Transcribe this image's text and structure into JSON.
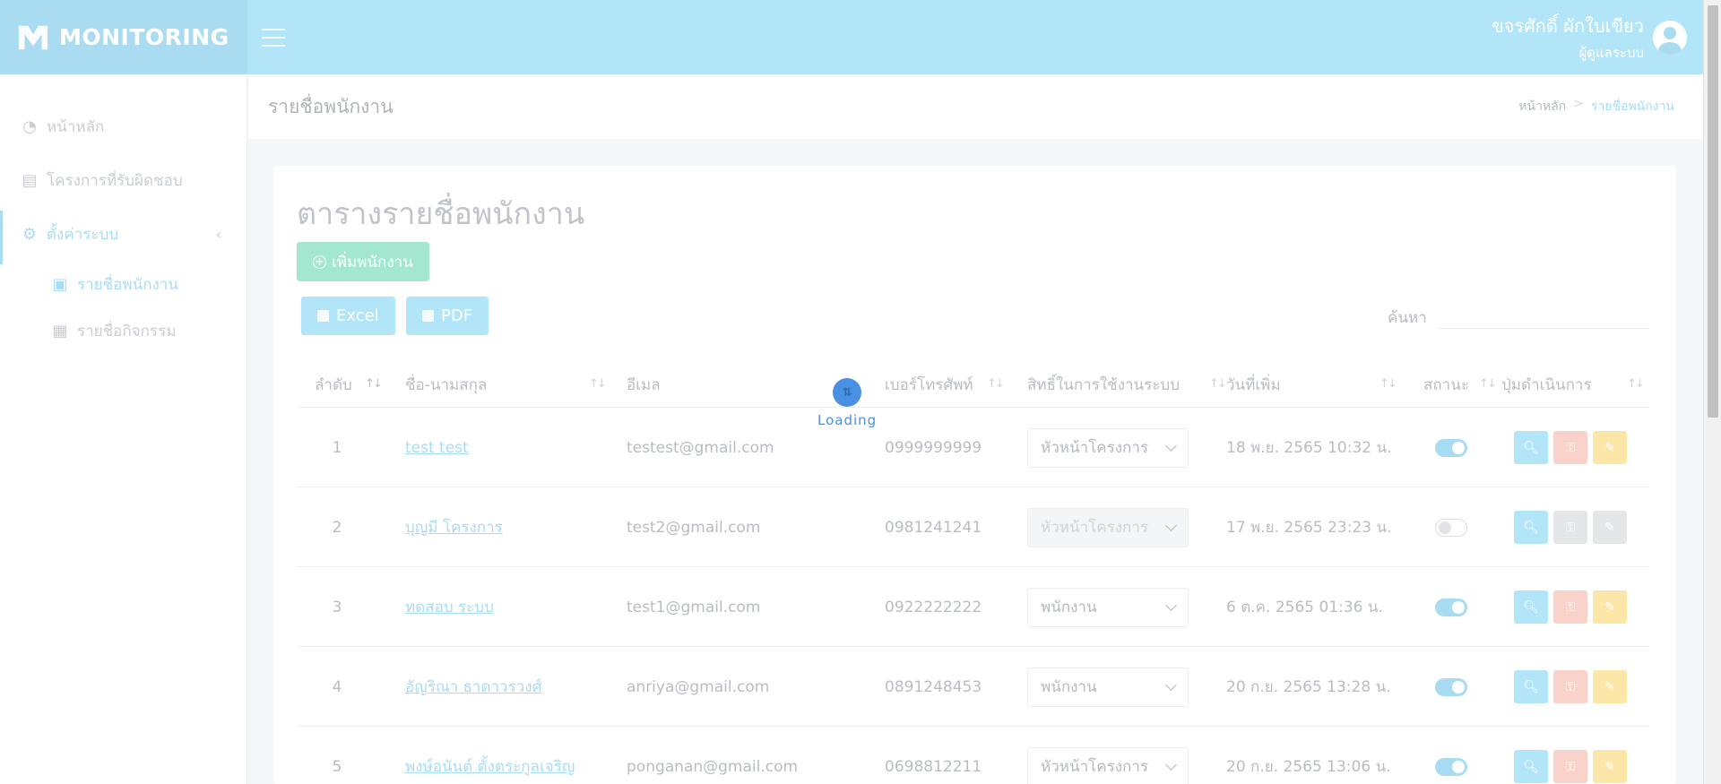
{
  "brand": {
    "name": "MONITORING"
  },
  "user": {
    "name": "ขจรศักดิ์ ผักใบเขียว",
    "role": "ผู้ดูแลระบบ"
  },
  "sidebar": {
    "items": [
      {
        "label": "หน้าหลัก",
        "icon": "chart-pie-icon"
      },
      {
        "label": "โครงการที่รับผิดชอบ",
        "icon": "document-list-icon"
      },
      {
        "label": "ตั้งค่าระบบ",
        "icon": "gear-icon"
      }
    ],
    "sub_items": [
      {
        "label": "รายชื่อพนักงาน",
        "icon": "id-card-icon"
      },
      {
        "label": "รายชื่อกิจกรรม",
        "icon": "table-icon"
      }
    ]
  },
  "page": {
    "title": "รายชื่อพนักงาน",
    "breadcrumb": {
      "home": "หน้าหลัก",
      "sep": ">",
      "current": "รายชื่อพนักงาน"
    }
  },
  "card": {
    "title": "ตารางรายชื่อพนักงาน",
    "add_label": "เพิ่มพนักงาน",
    "excel_label": "Excel",
    "pdf_label": "PDF",
    "search_label": "ค้นหา"
  },
  "table": {
    "headers": [
      "ลำดับ",
      "ชื่อ-นามสกุล",
      "อีเมล",
      "เบอร์โทรศัพท์",
      "สิทธิ์ในการใช้งานระบบ",
      "วันที่เพิ่ม",
      "สถานะ",
      "ปุ่มดำเนินการ"
    ],
    "rows": [
      {
        "no": "1",
        "name": "test test",
        "email": "testest@gmail.com",
        "phone": "0999999999",
        "role": "หัวหน้าโครงการ",
        "date": "18 พ.ย. 2565 10:32 น.",
        "active": true
      },
      {
        "no": "2",
        "name": "บุญมี โครงการ",
        "email": "test2@gmail.com",
        "phone": "0981241241",
        "role": "หัวหน้าโครงการ",
        "date": "17 พ.ย. 2565 23:23 น.",
        "active": false
      },
      {
        "no": "3",
        "name": "ทดสอบ ระบบ",
        "email": "test1@gmail.com",
        "phone": "0922222222",
        "role": "พนักงาน",
        "date": "6 ต.ค. 2565 01:36 น.",
        "active": true
      },
      {
        "no": "4",
        "name": "อัญริณา ธาดาวรวงศ์",
        "email": "anriya@gmail.com",
        "phone": "0891248453",
        "role": "พนักงาน",
        "date": "20 ก.ย. 2565 13:28 น.",
        "active": true
      },
      {
        "no": "5",
        "name": "พงษ์อนันต์ ตั้งตระกูลเจริญ",
        "email": "ponganan@gmail.com",
        "phone": "0698812211",
        "role": "หัวหน้าโครงการ",
        "date": "20 ก.ย. 2565 13:06 น.",
        "active": true
      }
    ]
  },
  "loading": {
    "text": "Loading"
  }
}
